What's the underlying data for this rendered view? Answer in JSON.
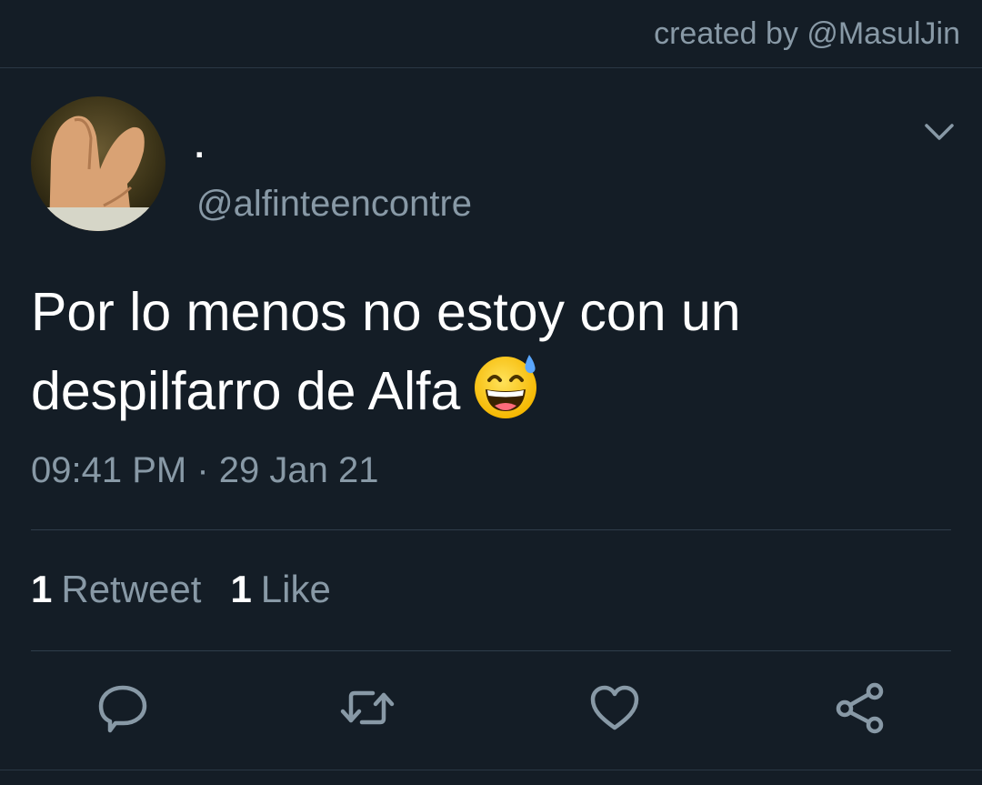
{
  "header": {
    "credit": "created by @MasulJin"
  },
  "tweet": {
    "display_name": ".",
    "handle": "@alfinteencontre",
    "text_line1": "Por lo menos no estoy con un",
    "text_line2": "despilfarro de Alfa",
    "emoji": "grinning-face-with-sweat",
    "time": "09:41 PM",
    "separator": "·",
    "date": "29 Jan 21",
    "retweet_count": "1",
    "retweet_label": "Retweet",
    "like_count": "1",
    "like_label": "Like"
  },
  "actions": {
    "reply_icon": "reply-icon",
    "retweet_icon": "retweet-icon",
    "like_icon": "heart-icon",
    "share_icon": "share-icon"
  },
  "colors": {
    "background": "#141d26",
    "primary_text": "#ffffff",
    "secondary_text": "#8899a6",
    "divider": "#2f3d4a"
  }
}
